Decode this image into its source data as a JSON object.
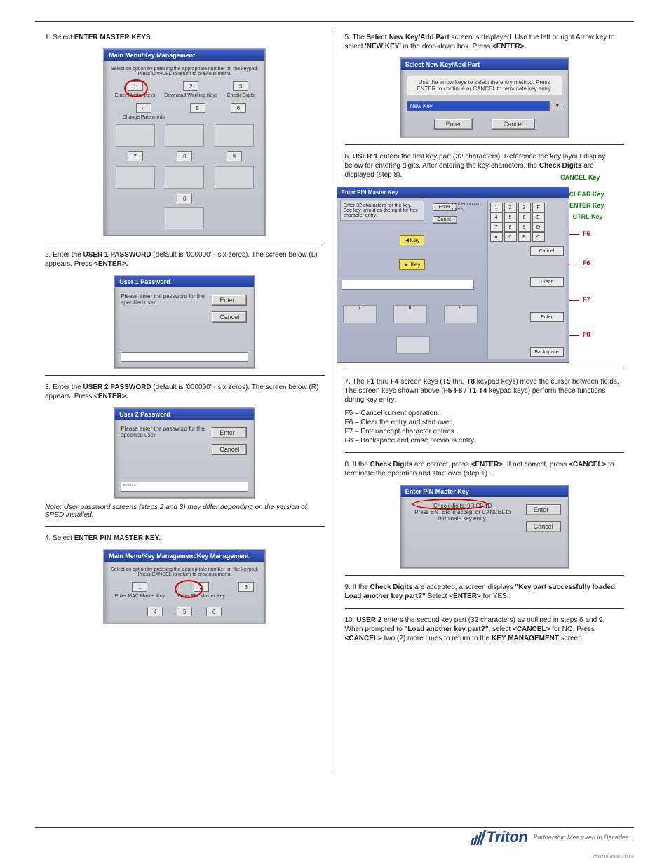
{
  "header_left": "",
  "header_right": "",
  "step1": {
    "label_prefix": "1. ",
    "label": "ENTER MASTER KEYS",
    "title": "Main Menu/Key Management",
    "hint": "Select an option by pressing the appropriate number on the keypad. Press CANCEL to return to previous menu.",
    "keys": [
      "1",
      "2",
      "3",
      "4",
      "5",
      "6",
      "7",
      "8",
      "9",
      "0"
    ],
    "cells": [
      "Enter Master Keys",
      "Download Working Keys",
      "Check Digits",
      "Change Passwords"
    ]
  },
  "step2": {
    "label_prefix": "2. ",
    "label_a": "Enter the ",
    "bold_a": "USER 1 PASSWORD",
    "label_b": " (default is '000000' - six zeros). The screen below (L) appears. Press ",
    "bold_b": "<ENTER>.",
    "title": "User 1 Password",
    "prompt": "Please enter the password for the specified user.",
    "enter": "Enter",
    "cancel": "Cancel"
  },
  "step3": {
    "label_prefix": "3. ",
    "label_a": "Enter the ",
    "bold_a": "USER 2 PASSWORD",
    "label_b": " (default is '000000' - six zeros). The screen below (R) appears. Press ",
    "bold_b": "<ENTER>.",
    "title": "User 2 Password",
    "prompt": "Please enter the password for the specified user.",
    "mask": "******",
    "enter": "Enter",
    "cancel": "Cancel",
    "note": "Note: User password screens (steps 2 and 3) may differ depending on the version of SPED installed."
  },
  "step4": {
    "label_prefix": "4. ",
    "label": "ENTER PIN MASTER KEY.",
    "title": "Main Menu/Key Management/Key Management",
    "hint": "Select an option by pressing the appropriate number on the keypad. Press CANCEL to return to previous menu.",
    "keys": [
      "1",
      "2",
      "3",
      "4",
      "5",
      "6"
    ],
    "cells": [
      "Enter MAC Master Key",
      "Enter PIN Master Key"
    ]
  },
  "step5": {
    "label_prefix": "5. ",
    "label_a": "The ",
    "bold_a": "Select New Key/Add Part",
    "label_b": " screen is displayed. Use the left or right Arrow key to select ",
    "bold_b": "'NEW KEY'",
    "label_c": " in the drop-down box. Press ",
    "bold_c": "<ENTER>.",
    "title": "Select New Key/Add Part",
    "prompt": "Use the arrow keys to select the entry method. Press ENTER to continue or CANCEL to terminate key entry.",
    "option": "New Key",
    "enter": "Enter",
    "cancel": "Cancel"
  },
  "step6": {
    "label_prefix": "6. ",
    "bold_a": "USER 1",
    "label_a": " enters the first key part (32 characters). Reference the key layout display below for entering digits. After entering the key characters, the ",
    "bold_b": "Check Digits",
    "label_b": " are displayed (step 8).",
    "title": "Enter PIN Master Key",
    "instr": "Enter 32 characters for the key. See key layout on the right for hex character entry.",
    "enter": "Enter",
    "cancel": "Cancel",
    "keypad_note": "umber on us menu.",
    "leftkey": "◄Key",
    "rightkey": "► Key",
    "side_cancel": "Cancel",
    "side_clear": "Clear",
    "side_enter": "Enter",
    "side_backspace": "Backspace",
    "pad": [
      [
        "1",
        "2",
        "3",
        "F"
      ],
      [
        "4",
        "5",
        "6",
        "E"
      ],
      [
        "7",
        "8",
        "9",
        "D"
      ],
      [
        "A",
        "0",
        "B",
        "C"
      ]
    ],
    "ann_cancel": "CANCEL Key",
    "ann_clear": "CLEAR Key",
    "ann_enter": "ENTER Key",
    "ann_ctrl": "CTRL Key",
    "ann_f5": "F5",
    "ann_f6": "F6",
    "ann_f7": "F7",
    "ann_f8": "F8",
    "numkeys": [
      "7",
      "8",
      "9"
    ]
  },
  "step7": {
    "label_prefix": "7. ",
    "label_a": "The ",
    "bold_a": "F1",
    "mid_a": " thru ",
    "bold_b": "F4",
    "label_b": " screen keys (",
    "bold_c": "T5",
    "mid_b": " thru ",
    "bold_d": "T8",
    "label_c": " keypad keys) move the cursor between fields. The screen keys shown above (",
    "bold_e": "F5-F8",
    "label_d": " / ",
    "bold_f": "T1-T4",
    "label_e": " keypad keys) perform these functions during key entry:",
    "item_f5": "F5 – Cancel current operation.",
    "item_f6": "F6 – Clear the entry and start over.",
    "item_f7": "F7 – Enter/accept character entries.",
    "item_f8": "F8 – Backspace and erase previous entry."
  },
  "step8": {
    "label_prefix": "8. ",
    "label_a": "If the ",
    "bold_a": "Check Digits",
    "label_b": " are correct, press ",
    "bold_b": "<ENTER>",
    "label_c": ". If not correct, press ",
    "bold_c": "<CANCEL>",
    "label_d": " to terminate the operation and start over (step 1).",
    "title": "Enter PIN Master Key",
    "check": "Check digits: 9D C9 1D",
    "prompt": "Press ENTER to accept or CANCEL to terminate key entry.",
    "enter": "Enter",
    "cancel": "Cancel"
  },
  "step9": {
    "label_prefix": "9. ",
    "label_a": "If the ",
    "bold_a": "Check Digits",
    "label_b": " are accepted, a screen displays ",
    "bold_b": "\"Key part successfully loaded. Load another key part?\"",
    "label_c": " Select ",
    "bold_c": "<ENTER>",
    "label_d": " for YES."
  },
  "step10": {
    "label_prefix": "10. ",
    "bold_a": "USER 2",
    "label_a": " enters the second key part (32 characters) as outlined in steps 6 and 9. When prompted to ",
    "bold_b": "\"Load another key part?\"",
    "label_b": ", select ",
    "bold_c": "<CANCEL>",
    "label_c": " for NO. Press ",
    "bold_d": "<CANCEL>",
    "label_d": " two (2) more times to return to the ",
    "bold_e": "KEY MANAGEMENT",
    "label_e": " screen."
  },
  "footer": {
    "brand": "Triton",
    "tag": "Partnership Measured in Decades...",
    "site": "www.tritonatm.com",
    "page_left": "",
    "page_right": ""
  }
}
